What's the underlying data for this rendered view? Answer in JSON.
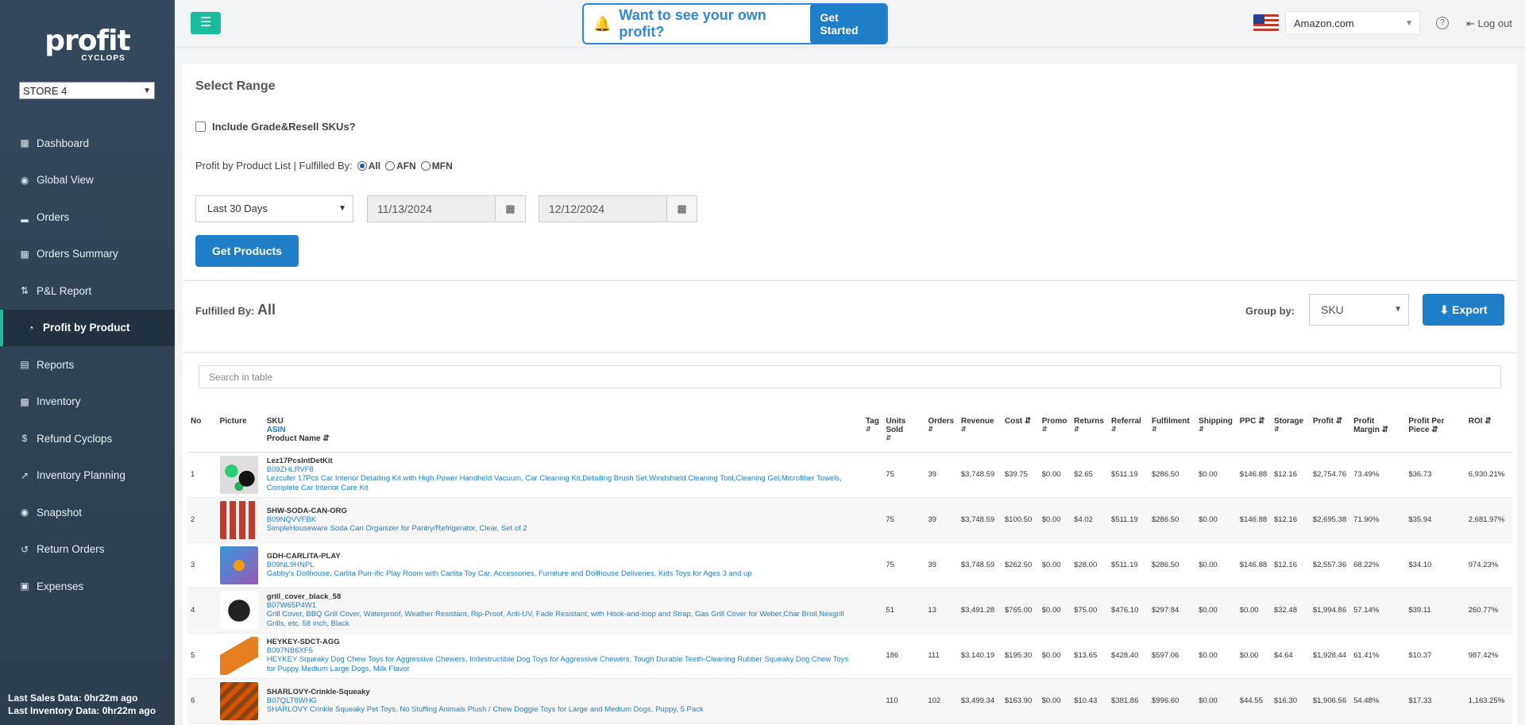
{
  "app": {
    "logo_main": "profit",
    "logo_sub": "CYCLOPS",
    "store": "STORE 4"
  },
  "sidebar": {
    "items": [
      {
        "label": "Dashboard",
        "icon": "grid-icon"
      },
      {
        "label": "Global View",
        "icon": "globe-icon"
      },
      {
        "label": "Orders",
        "icon": "bar-chart-icon"
      },
      {
        "label": "Orders Summary",
        "icon": "table-icon"
      },
      {
        "label": "P&L Report",
        "icon": "sort-icon"
      },
      {
        "label": "Profit by Product",
        "icon": "pie-chart-icon",
        "active": true
      },
      {
        "label": "Reports",
        "icon": "book-icon"
      },
      {
        "label": "Inventory",
        "icon": "briefcase-icon"
      },
      {
        "label": "Refund Cyclops",
        "icon": "dollar-icon"
      },
      {
        "label": "Inventory Planning",
        "icon": "line-chart-icon"
      },
      {
        "label": "Snapshot",
        "icon": "camera-icon"
      },
      {
        "label": "Return Orders",
        "icon": "undo-icon"
      },
      {
        "label": "Expenses",
        "icon": "money-icon"
      }
    ],
    "footer_sales": "Last Sales Data: 0hr22m ago",
    "footer_inventory": "Last Inventory Data: 0hr22m ago"
  },
  "topbar": {
    "promo_text": "Want to see your own profit?",
    "promo_button": "Get Started",
    "marketplace": "Amazon.com",
    "logout": "Log out"
  },
  "range": {
    "title": "Select Range",
    "include_label": "Include Grade&Resell SKUs?",
    "filter_label": "Profit by Product List | Fulfilled By:",
    "radio_all": "All",
    "radio_afn": "AFN",
    "radio_mfn": "MFN",
    "period": "Last 30 Days",
    "start_date": "11/13/2024",
    "end_date": "12/12/2024",
    "get_button": "Get Products"
  },
  "toolbar": {
    "fulfilled_label": "Fulfilled By:",
    "fulfilled_value": "All",
    "group_label": "Group by:",
    "group_value": "SKU",
    "export_label": "Export"
  },
  "table": {
    "search_placeholder": "Search in table",
    "headers": {
      "no": "No",
      "picture": "Picture",
      "sku": "SKU",
      "asin": "ASIN",
      "product_name": "Product Name",
      "tag": "Tag",
      "units": "Units Sold",
      "orders": "Orders",
      "revenue": "Revenue",
      "cost": "Cost",
      "promo": "Promo",
      "returns": "Returns",
      "referral": "Referral",
      "fulfilment": "Fulfilment",
      "shipping": "Shipping",
      "ppc": "PPC",
      "storage": "Storage",
      "profit": "Profit",
      "margin": "Profit Margin",
      "per_piece": "Profit Per Piece",
      "roi": "ROI"
    },
    "rows": [
      {
        "no": "1",
        "sku": "Lez17PcsIntDetKit",
        "asin": "B09ZHLRVF8",
        "name": "Lezcufer 17Pcs Car Interior Detailing Kit with High Power Handheld Vacuum, Car Cleaning Kit,Detailing Brush Set,Windshield Cleaning Tool,Cleaning Gel,Microfiber Towels, Complete Car Interior Care Kit",
        "units": "75",
        "orders": "39",
        "revenue": "$3,748.59",
        "cost": "$39.75",
        "promo": "$0.00",
        "returns": "$2.65",
        "referral": "$511.19",
        "fulfilment": "$286.50",
        "shipping": "$0.00",
        "ppc": "$146.88",
        "storage": "$12.16",
        "profit": "$2,754.76",
        "margin": "73.49%",
        "per_piece": "$36.73",
        "roi": "6,930.21%"
      },
      {
        "no": "2",
        "sku": "SHW-SODA-CAN-ORG",
        "asin": "B09NQVVFBK",
        "name": "SimpleHouseware Soda Can Organizer for Pantry/Refrigerator, Clear, Set of 2",
        "units": "75",
        "orders": "39",
        "revenue": "$3,748.59",
        "cost": "$100.50",
        "promo": "$0.00",
        "returns": "$4.02",
        "referral": "$511.19",
        "fulfilment": "$286.50",
        "shipping": "$0.00",
        "ppc": "$146.88",
        "storage": "$12.16",
        "profit": "$2,695.38",
        "margin": "71.90%",
        "per_piece": "$35.94",
        "roi": "2,681.97%"
      },
      {
        "no": "3",
        "sku": "GDH-CARLITA-PLAY",
        "asin": "B09NL9HNPL",
        "name": "Gabby's Dollhouse, Carlita Purr-ific Play Room with Carlita Toy Car, Accessories, Furniture and Dollhouse Deliveries, Kids Toys for Ages 3 and up",
        "units": "75",
        "orders": "39",
        "revenue": "$3,748.59",
        "cost": "$262.50",
        "promo": "$0.00",
        "returns": "$28.00",
        "referral": "$511.19",
        "fulfilment": "$286.50",
        "shipping": "$0.00",
        "ppc": "$146.88",
        "storage": "$12.16",
        "profit": "$2,557.36",
        "margin": "68.22%",
        "per_piece": "$34.10",
        "roi": "974.23%"
      },
      {
        "no": "4",
        "sku": "grill_cover_black_58",
        "asin": "B07W65P4W1",
        "name": "Grill Cover, BBQ Grill Cover, Waterproof, Weather Resistant, Rip-Proof, Anti-UV, Fade Resistant, with Hook-and-loop and Strap, Gas Grill Cover for Weber,Char Broil,Nexgrill Grills, etc. 58 inch, Black",
        "units": "51",
        "orders": "13",
        "revenue": "$3,491.28",
        "cost": "$765.00",
        "promo": "$0.00",
        "returns": "$75.00",
        "referral": "$476.10",
        "fulfilment": "$297.84",
        "shipping": "$0.00",
        "ppc": "$0.00",
        "storage": "$32.48",
        "profit": "$1,994.86",
        "margin": "57.14%",
        "per_piece": "$39.11",
        "roi": "260.77%"
      },
      {
        "no": "5",
        "sku": "HEYKEY-SDCT-AGG",
        "asin": "B097NB6XF5",
        "name": "HEYKEY Squeaky Dog Chew Toys for Aggressive Chewers, Indestructible Dog Toys for Aggressive Chewers, Tough Durable Teeth-Cleaning Rubber Squeaky Dog Chew Toys for Puppy Medium Large Dogs, Milk Flavor",
        "units": "186",
        "orders": "111",
        "revenue": "$3,140.19",
        "cost": "$195.30",
        "promo": "$0.00",
        "returns": "$13.65",
        "referral": "$428.40",
        "fulfilment": "$597.06",
        "shipping": "$0.00",
        "ppc": "$0.00",
        "storage": "$4.64",
        "profit": "$1,928.44",
        "margin": "61.41%",
        "per_piece": "$10.37",
        "roi": "987.42%"
      },
      {
        "no": "6",
        "sku": "SHARLOVY-Crinkle-Squeaky",
        "asin": "B07QLT8WHG",
        "name": "SHARLOVY Crinkle Squeaky Pet Toys, No Stuffing Animals Plush / Chew Doggie Toys for Large and Medium Dogs, Puppy, 5 Pack",
        "units": "110",
        "orders": "102",
        "revenue": "$3,499.34",
        "cost": "$163.90",
        "promo": "$0.00",
        "returns": "$10.43",
        "referral": "$381.86",
        "fulfilment": "$996.60",
        "shipping": "$0.00",
        "ppc": "$44.55",
        "storage": "$16.30",
        "profit": "$1,906.56",
        "margin": "54.48%",
        "per_piece": "$17.33",
        "roi": "1,163.25%"
      }
    ]
  }
}
